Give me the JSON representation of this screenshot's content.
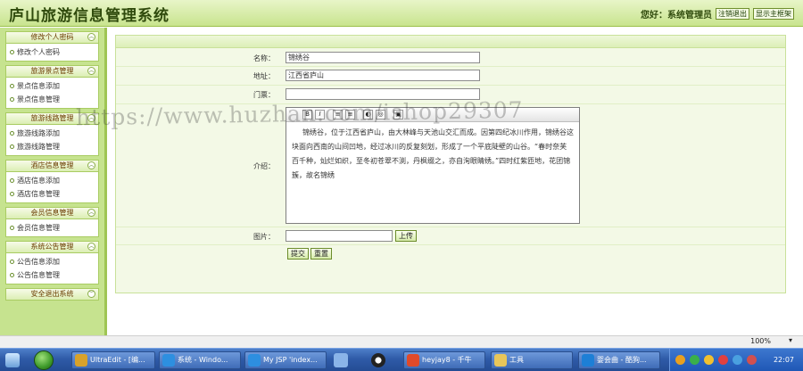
{
  "header": {
    "title": "庐山旅游信息管理系统",
    "greeting": "您好：系统管理员",
    "logout_label": "注销退出",
    "home_label": "显示主框架"
  },
  "sidebar": {
    "groups": [
      {
        "title": "修改个人密码",
        "items": [
          "修改个人密码"
        ]
      },
      {
        "title": "旅游景点管理",
        "items": [
          "景点信息添加",
          "景点信息管理"
        ]
      },
      {
        "title": "旅游线路管理",
        "items": [
          "旅游线路添加",
          "旅游线路管理"
        ]
      },
      {
        "title": "酒店信息管理",
        "items": [
          "酒店信息添加",
          "酒店信息管理"
        ]
      },
      {
        "title": "会员信息管理",
        "items": [
          "会员信息管理"
        ]
      },
      {
        "title": "系统公告管理",
        "items": [
          "公告信息添加",
          "公告信息管理"
        ]
      },
      {
        "title": "安全退出系统",
        "items": []
      }
    ]
  },
  "form": {
    "name_label": "名称：",
    "name_value": "锦绣谷",
    "address_label": "地址：",
    "address_value": "江西省庐山",
    "ticket_label": "门票：",
    "ticket_value": "",
    "intro_label": "介绍：",
    "intro_value": "锦绣谷，位于江西省庐山，由大林峰与天池山交汇而成。因第四纪冰川作用，锦绣谷这块面向西南的山间凹地，经过冰川的反复刻划，形成了一个平底陡壁的山谷。“春时奈芙百千种，灿烂如织，至冬初苍翠不渕，丹枫缀之，亦自洵眼睛绣。”四时红紫匝地，花团锦簇，故名锦绣",
    "toolbar": [
      "B",
      "I",
      "≡",
      "≡",
      "◐",
      "◎",
      "▣"
    ],
    "image_label": "图片：",
    "upload_label": "上传",
    "submit_label": "提交",
    "reset_label": "重置"
  },
  "statusbar": {
    "zoom": "100%"
  },
  "taskbar": {
    "items": [
      "UltraEdit - [编...",
      "系统 - Windo...",
      "My JSP 'index...",
      "heyjay8 - 千牛",
      "工具",
      "婴会曲 - 酷狗..."
    ],
    "clock": "22:07"
  },
  "watermark": "https://www.huzhan.com/ishop29307",
  "colors": {
    "brand_green": "#c6e38f",
    "title_green": "#2f4a0c",
    "taskbar_blue": "#2f5ba8"
  }
}
